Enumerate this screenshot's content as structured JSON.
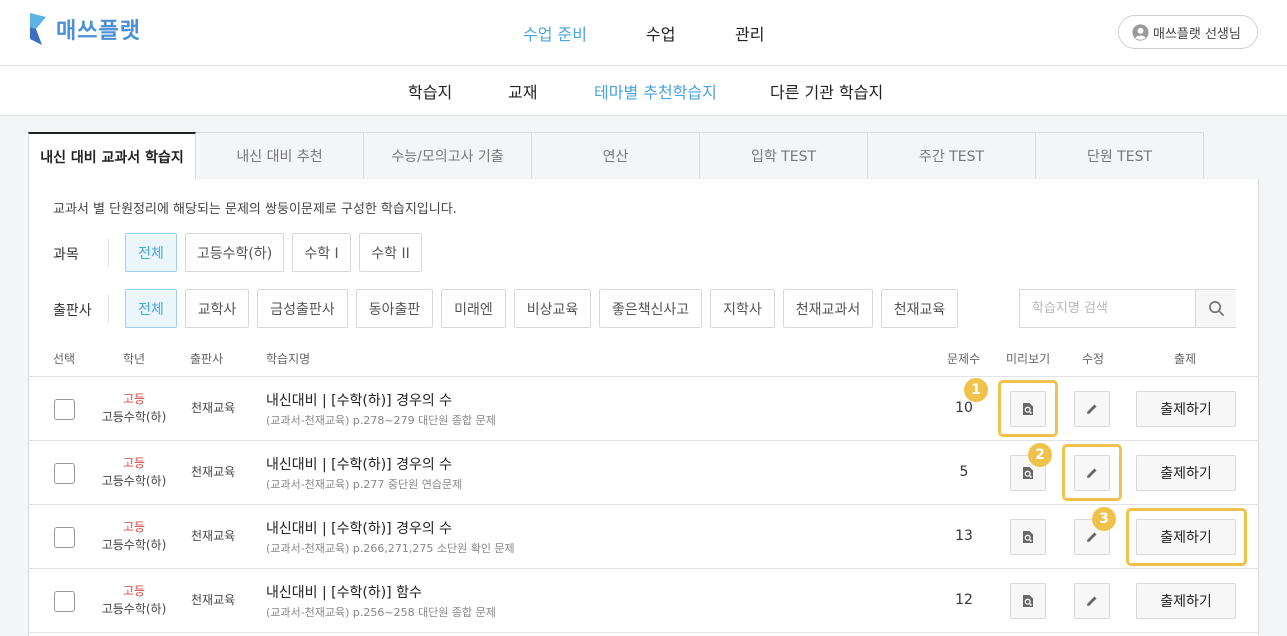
{
  "app": {
    "logo_text": "매쓰플랫",
    "brand_color": "#4aa3df"
  },
  "top_nav": {
    "items": [
      {
        "label": "수업 준비",
        "active": true
      },
      {
        "label": "수업",
        "active": false
      },
      {
        "label": "관리",
        "active": false
      }
    ],
    "user_label": "매쓰플랫 선생님"
  },
  "sub_nav": {
    "items": [
      {
        "label": "학습지",
        "active": false
      },
      {
        "label": "교재",
        "active": false
      },
      {
        "label": "테마별 추천학습지",
        "active": true
      },
      {
        "label": "다른 기관 학습지",
        "active": false
      }
    ]
  },
  "tabs": [
    {
      "label": "내신 대비 교과서 학습지",
      "active": true
    },
    {
      "label": "내신 대비 추천",
      "active": false
    },
    {
      "label": "수능/모의고사 기출",
      "active": false
    },
    {
      "label": "연산",
      "active": false
    },
    {
      "label": "입학 TEST",
      "active": false
    },
    {
      "label": "주간 TEST",
      "active": false
    },
    {
      "label": "단원 TEST",
      "active": false
    }
  ],
  "description": "교과서 별 단원정리에 해당되는 문제의 쌍둥이문제로 구성한 학습지입니다.",
  "filters": {
    "subject": {
      "label": "과목",
      "options": [
        "전체",
        "고등수학(하)",
        "수학 I",
        "수학 II"
      ],
      "selected": "전체"
    },
    "publisher": {
      "label": "출판사",
      "options": [
        "전체",
        "교학사",
        "금성출판사",
        "동아출판",
        "미래엔",
        "비상교육",
        "좋은책신사고",
        "지학사",
        "천재교과서",
        "천재교육"
      ],
      "selected": "전체"
    }
  },
  "search": {
    "placeholder": "학습지명 검색",
    "value": ""
  },
  "table": {
    "headers": {
      "select": "선택",
      "grade": "학년",
      "publisher": "출판사",
      "name": "학습지명",
      "count": "문제수",
      "preview": "미리보기",
      "edit": "수정",
      "issue": "출제"
    },
    "rows": [
      {
        "grade": "고등",
        "subject": "고등수학(하)",
        "publisher": "천재교육",
        "title": "내신대비 | [수학(하)] 경우의 수",
        "source": "(교과서-천재교육) p.278~279 대단원 종합 문제",
        "count": "10",
        "issue_label": "출제하기"
      },
      {
        "grade": "고등",
        "subject": "고등수학(하)",
        "publisher": "천재교육",
        "title": "내신대비 | [수학(하)] 경우의 수",
        "source": "(교과서-천재교육) p.277 중단원 연습문제",
        "count": "5",
        "issue_label": "출제하기"
      },
      {
        "grade": "고등",
        "subject": "고등수학(하)",
        "publisher": "천재교육",
        "title": "내신대비 | [수학(하)] 경우의 수",
        "source": "(교과서-천재교육) p.266,271,275 소단원 확인 문제",
        "count": "13",
        "issue_label": "출제하기"
      },
      {
        "grade": "고등",
        "subject": "고등수학(하)",
        "publisher": "천재교육",
        "title": "내신대비 | [수학(하)] 함수",
        "source": "(교과서-천재교육) p.256~258 대단원 종합 문제",
        "count": "12",
        "issue_label": "출제하기"
      }
    ]
  },
  "callouts": [
    "1",
    "2",
    "3"
  ],
  "callout_color": "#f0c24b"
}
